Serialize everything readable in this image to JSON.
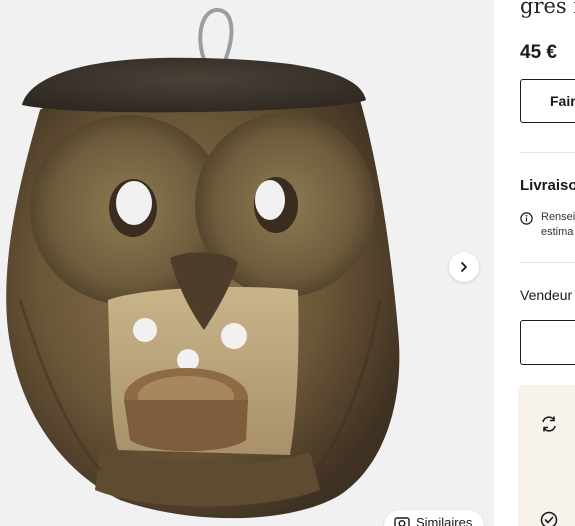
{
  "product": {
    "title": "grès fo",
    "price": "45 €",
    "image_alt": "Stoneware owl lantern"
  },
  "gallery": {
    "next_icon": "chevron-right-icon",
    "similar_label": "Similaires",
    "similar_icon": "camera-search-icon"
  },
  "actions": {
    "offer_label": "Fair"
  },
  "delivery": {
    "title": "Livraiso",
    "info_icon": "info-icon",
    "note_line1": "Rensei",
    "note_line2": "estima"
  },
  "seller": {
    "title": "Vendeur"
  },
  "perks": {
    "icons": [
      "refresh-arrows-icon",
      "check-badge-icon"
    ]
  },
  "colors": {
    "background": "#ffffff",
    "gallery_bg": "#f1f1f1",
    "text": "#1a1a1a",
    "perks_bg": "#f7f2ec"
  }
}
